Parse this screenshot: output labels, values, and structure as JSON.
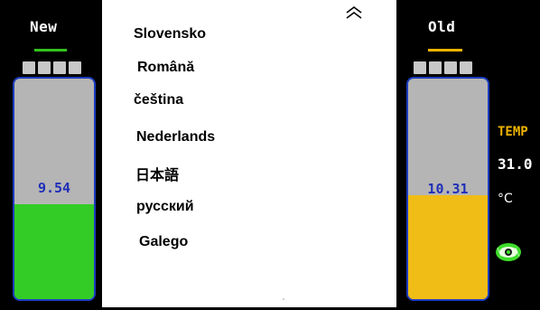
{
  "new_battery": {
    "label": "New",
    "value": "9.54",
    "level": 0.43
  },
  "old_battery": {
    "label": "Old",
    "value": "10.31",
    "level": 0.47
  },
  "temperature": {
    "label": "TEMP",
    "value": "31.0",
    "unit": "°C"
  },
  "language_menu": {
    "items": [
      "Slovensko",
      "Română",
      "čeština",
      "Nederlands",
      "日本語",
      "русский",
      "Galego"
    ],
    "scroll_up_icon": "double-chevron-up-icon"
  },
  "colors": {
    "new_accent": "#34c21e",
    "old_accent": "#f0b400",
    "battery_outline": "#1c3cbf",
    "value_text": "#1f2fb8"
  }
}
